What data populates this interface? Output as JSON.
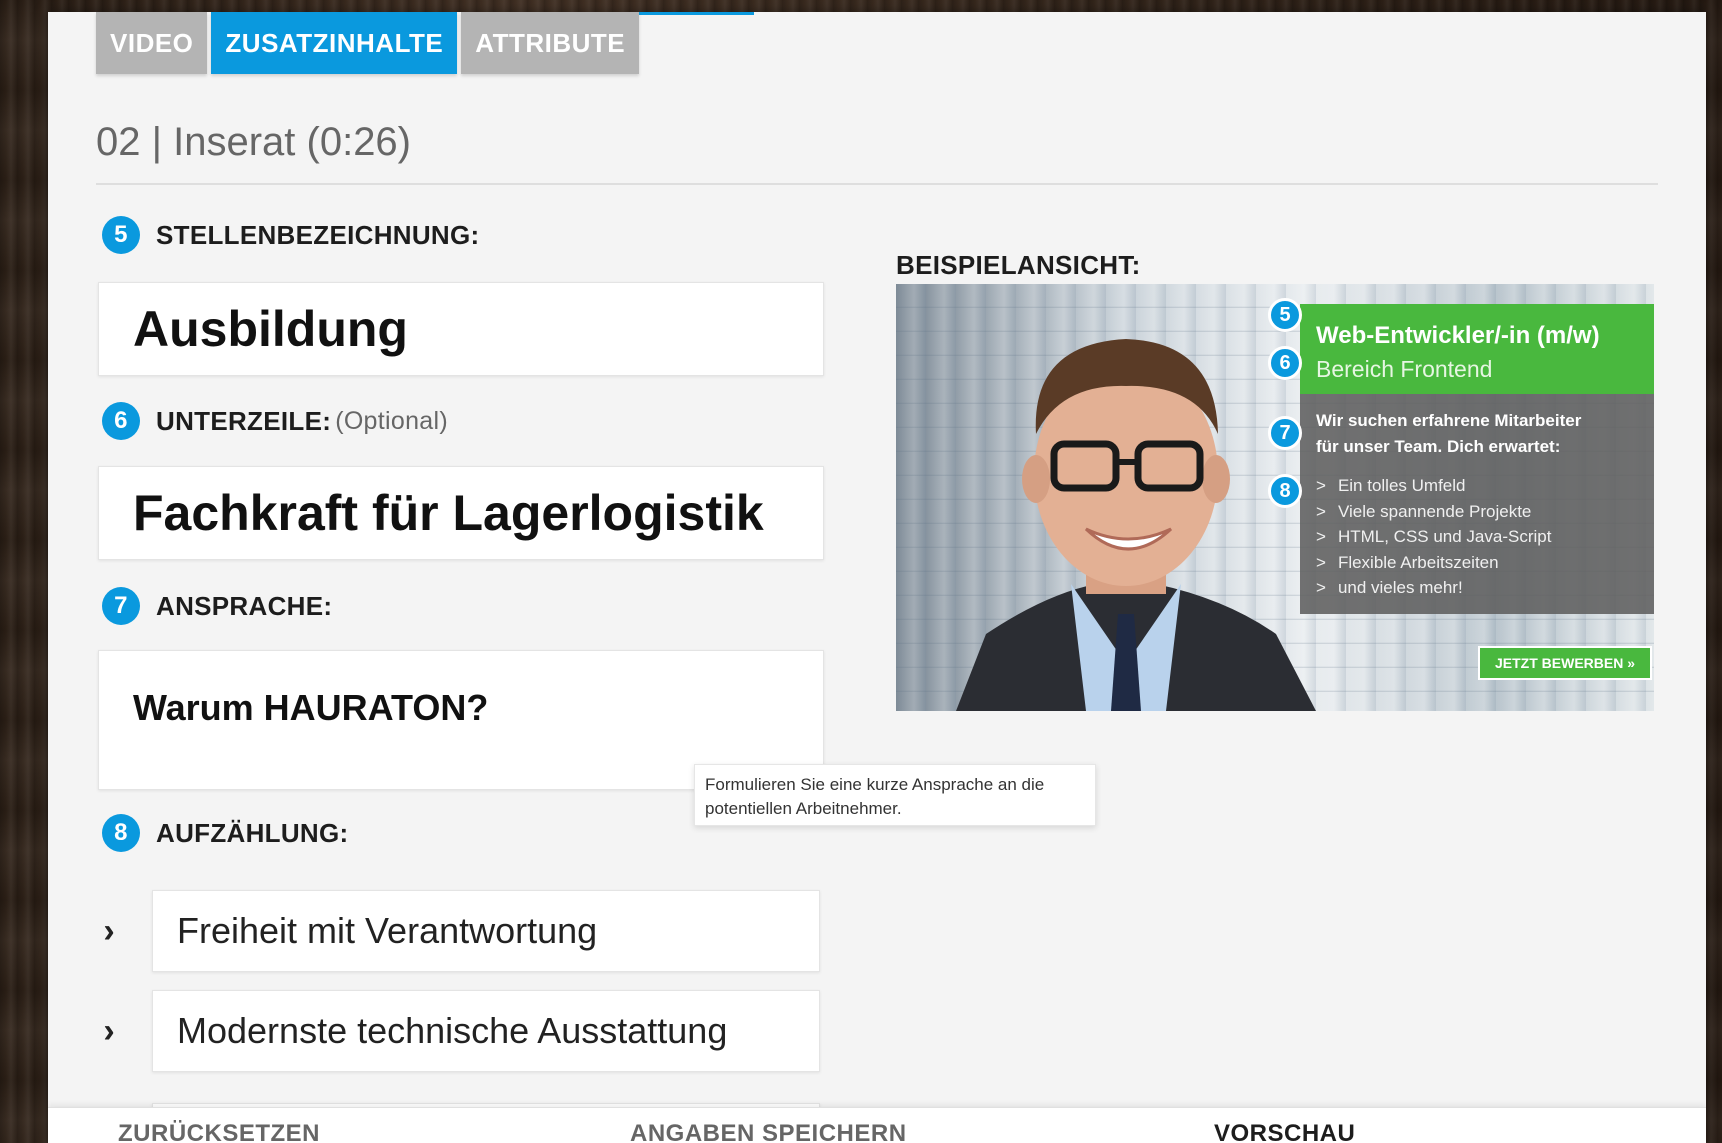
{
  "tabs": [
    {
      "label": "VIDEO",
      "active": false
    },
    {
      "label": "ZUSATZINHALTE",
      "active": true
    },
    {
      "label": "ATTRIBUTE",
      "active": false
    }
  ],
  "page_title": "02 | Inserat (0:26)",
  "fields": {
    "title": {
      "number": "5",
      "label": "STELLENBEZEICHNUNG:",
      "value": "Ausbildung"
    },
    "subtitle": {
      "number": "6",
      "label": "UNTERZEILE:",
      "optional": "(Optional)",
      "value": "Fachkraft für Lagerlogistik"
    },
    "address": {
      "number": "7",
      "label": "ANSPRACHE:",
      "value": "Warum HAURATON?"
    },
    "bullets": {
      "number": "8",
      "label": "AUFZÄHLUNG:",
      "items": [
        "Freiheit mit Verantwortung",
        "Modernste technische Ausstattung"
      ]
    }
  },
  "tooltip": "Formulieren Sie eine kurze Ansprache an die potentiellen Arbeitnehmer.",
  "preview": {
    "label": "BEISPIELANSICHT:",
    "title": "Web-Entwickler/-in (m/w)",
    "subtitle": "Bereich Frontend",
    "intro_line1": "Wir suchen erfahrene Mitarbeiter",
    "intro_line2": "für unser Team. Dich erwartet:",
    "list": [
      "Ein tolles Umfeld",
      "Viele spannende Projekte",
      "HTML, CSS und Java-Script",
      "Flexible Arbeitszeiten",
      "und vieles mehr!"
    ],
    "badges": [
      "5",
      "6",
      "7",
      "8"
    ],
    "cta": "JETZT BEWERBEN »"
  },
  "bottom_bar": {
    "reset": "ZURÜCKSETZEN",
    "save": "ANGABEN SPEICHERN",
    "preview": "VORSCHAU"
  },
  "colors": {
    "accent": "#0a99de",
    "green": "#49b83e",
    "tab_inactive": "#b4b4b4"
  }
}
